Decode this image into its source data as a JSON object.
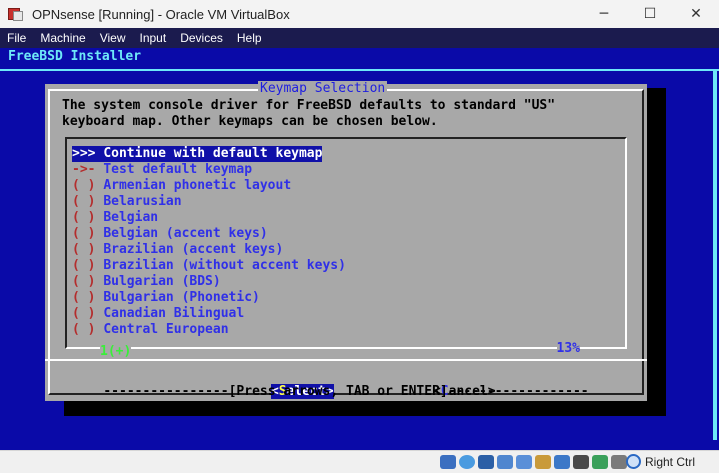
{
  "window": {
    "title": "OPNsense [Running] - Oracle VM VirtualBox",
    "minimize_glyph": "─",
    "maximize_glyph": "☐",
    "close_glyph": "✕"
  },
  "menubar": {
    "items": [
      "File",
      "Machine",
      "View",
      "Input",
      "Devices",
      "Help"
    ]
  },
  "console": {
    "installer_title": "FreeBSD Installer",
    "dialog": {
      "title": "Keymap Selection",
      "intro_line1": "The system console driver for FreeBSD defaults to standard \"US\"",
      "intro_line2": "keyboard map. Other keymaps can be chosen below.",
      "items": [
        {
          "mark": ">>>",
          "label": "Continue with default keymap",
          "selected": true
        },
        {
          "mark": "->-",
          "label": "Test default keymap"
        },
        {
          "mark": "( )",
          "label": "Armenian phonetic layout"
        },
        {
          "mark": "( )",
          "label": "Belarusian"
        },
        {
          "mark": "( )",
          "label": "Belgian"
        },
        {
          "mark": "( )",
          "label": "Belgian (accent keys)"
        },
        {
          "mark": "( )",
          "label": "Brazilian (accent keys)"
        },
        {
          "mark": "( )",
          "label": "Brazilian (without accent keys)"
        },
        {
          "mark": "( )",
          "label": "Bulgarian (BDS)"
        },
        {
          "mark": "( )",
          "label": "Bulgarian (Phonetic)"
        },
        {
          "mark": "( )",
          "label": "Canadian Bilingual"
        },
        {
          "mark": "( )",
          "label": "Central European"
        }
      ],
      "scroll_indicator": "1(+)",
      "scroll_percent": "13%",
      "select_button": {
        "open": "<",
        "hotkey": "S",
        "rest": "elect",
        "close": ">"
      },
      "cancel_button": {
        "open": "<",
        "hotkey": "C",
        "rest": "ancel",
        "close": ">"
      },
      "help_bar": "----------------[Press arrows, TAB or ENTER]------------------"
    }
  },
  "statusbar": {
    "host_key": "Right Ctrl",
    "icons": [
      "hard-disk-icon",
      "optical-drive-icon",
      "audio-icon",
      "network-icon",
      "usb-icon",
      "shared-folder-icon",
      "display-icon",
      "recording-icon",
      "cpu-icon",
      "mouse-integration-icon"
    ]
  },
  "colors": {
    "console_bg": "#0a0aa8",
    "dialog_bg": "#a8a8a8",
    "title_cyan": "#6ee8f8",
    "item_blue": "#3030e8",
    "mark_red": "#b42d2d",
    "select_bg": "#1010a8",
    "hotkey_yellow": "#ffff48",
    "scroll_green": "#38f038"
  }
}
